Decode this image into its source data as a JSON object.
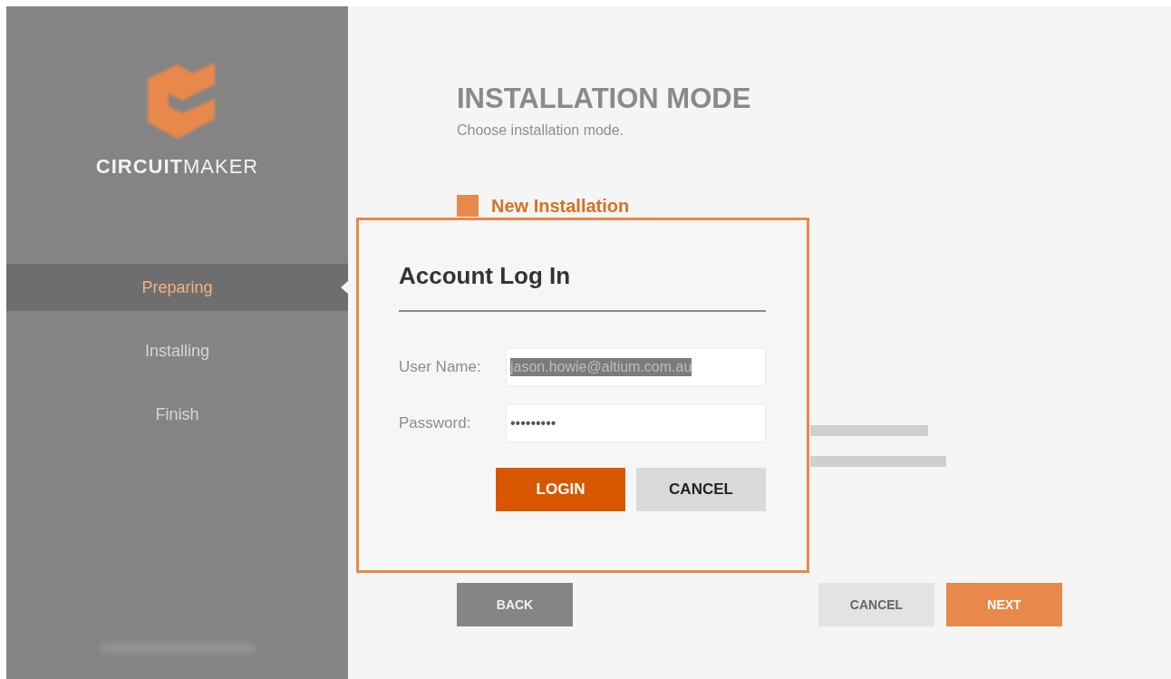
{
  "sidebar": {
    "brand": "**CIRCUIT**MAKER",
    "steps": [
      {
        "label": "Preparing",
        "selected": true
      },
      {
        "label": "Installing",
        "selected": false
      },
      {
        "label": "Finish",
        "selected": false
      }
    ]
  },
  "page": {
    "title": "INSTALLATION MODE",
    "subtitle": "Choose installation mode.",
    "options": [
      {
        "label": "New Installation",
        "checked": true
      }
    ],
    "buttons": [
      {
        "label": "BACK",
        "kind": "back"
      },
      {
        "label": "CANCEL",
        "kind": "secondary"
      },
      {
        "label": "NEXT",
        "kind": "primary"
      }
    ]
  },
  "dialog": {
    "title": "Account Log In",
    "fields": [
      {
        "label": "User Name:",
        "value": "jason.howie@altium.com.au",
        "highlighted": true
      },
      {
        "label": "Password:",
        "value": "•••••••••",
        "highlighted": false
      }
    ],
    "buttons": [
      {
        "label": "LOGIN",
        "kind": "primary"
      },
      {
        "label": "CANCEL",
        "kind": "secondary"
      }
    ]
  }
}
